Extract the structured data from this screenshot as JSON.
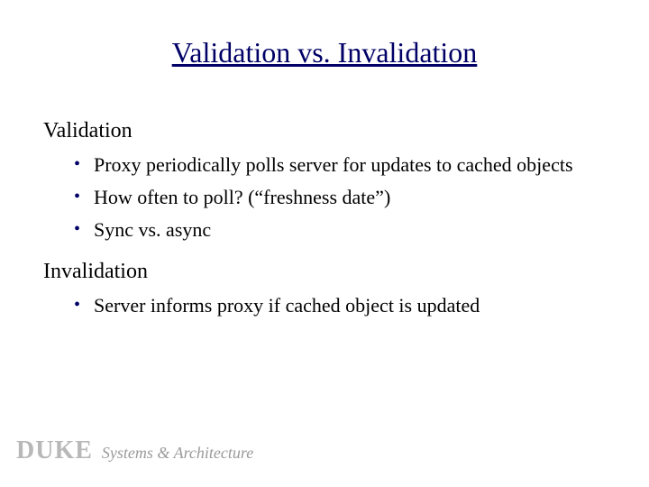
{
  "title": "Validation vs. Invalidation",
  "sections": [
    {
      "heading": "Validation",
      "bullets": [
        "Proxy periodically polls server for updates to cached objects",
        "How often to poll?  (“freshness date”)",
        "Sync vs. async"
      ]
    },
    {
      "heading": "Invalidation",
      "bullets": [
        "Server informs proxy if cached object is updated"
      ]
    }
  ],
  "footer": {
    "brand": "DUKE",
    "tagline": "Systems & Architecture"
  }
}
